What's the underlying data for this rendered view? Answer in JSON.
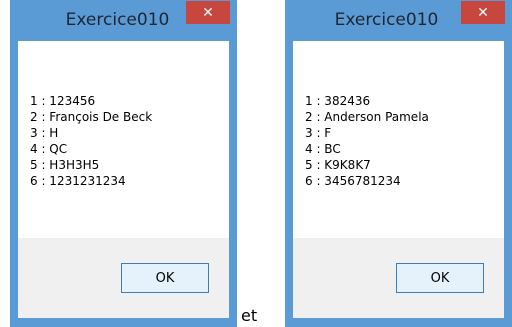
{
  "dialogs": [
    {
      "title": "Exercice010",
      "lines": [
        "1 : 123456",
        "2 : François De Beck",
        "3 : H",
        "4 : QC",
        "5 : H3H3H5",
        "6 : 1231231234"
      ],
      "ok_label": "OK",
      "close_symbol": "✕"
    },
    {
      "title": "Exercice010",
      "lines": [
        "1 : 382436",
        "2 : Anderson Pamela",
        "3 : F",
        "4 : BC",
        "5 : K9K8K7",
        "6 : 3456781234"
      ],
      "ok_label": "OK",
      "close_symbol": "✕"
    }
  ],
  "separator_text": "et",
  "colors": {
    "frame": "#5b9bd5",
    "close_button": "#c7463d",
    "footer": "#f0f0f0",
    "ok_border": "#3c7fb1"
  },
  "icons": {
    "close": "close-icon"
  }
}
